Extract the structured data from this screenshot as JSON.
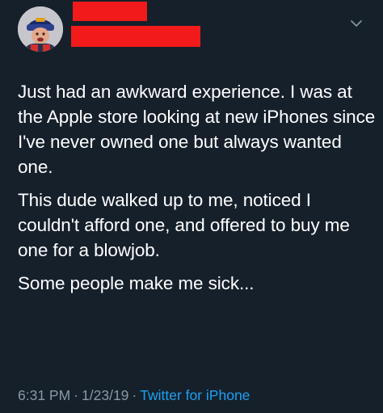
{
  "tweet": {
    "paragraphs": [
      "Just had an awkward experience. I was at the Apple store looking at new iPhones since I've never owned one but always wanted one.",
      "This dude walked up to me, noticed I couldn't afford one, and offered to buy me one for a blowjob.",
      "Some people make me sick..."
    ],
    "time": "6:31 PM",
    "separator": "·",
    "date": "1/23/19",
    "source": "Twitter for iPhone"
  },
  "icons": {
    "menu": "chevron-down-icon",
    "avatar": "avatar"
  },
  "colors": {
    "background": "#15202b",
    "text": "#ffffff",
    "muted": "#8899a6",
    "link": "#1da1f2",
    "redaction": "#f21a1a"
  }
}
